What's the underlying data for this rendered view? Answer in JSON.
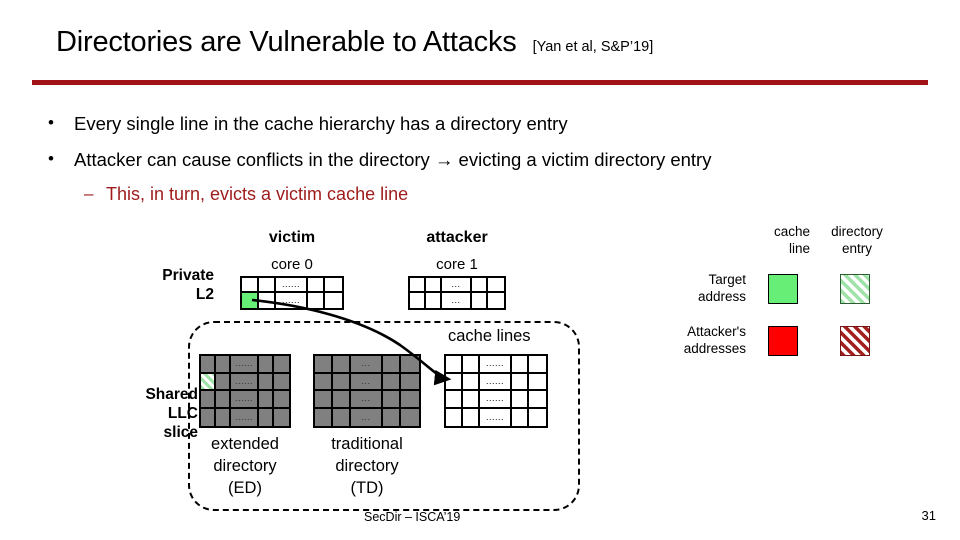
{
  "slide": {
    "title": "Directories are Vulnerable to Attacks",
    "citation": "[Yan et al, S&P’19]",
    "accent_color": "#A01216",
    "sub_bullet_color": "#9E1B1B",
    "footer": "SecDir – ISCA’19",
    "page_number": "31"
  },
  "bullets": [
    {
      "marker": "•",
      "text": "Every single line in the cache hierarchy has a directory entry",
      "level": 1
    },
    {
      "marker": "•",
      "text": "Attacker can cause conflicts in the directory → evicting a victim directory entry",
      "level": 1
    },
    {
      "marker": "–",
      "text": "This, in turn, evicts a victim cache line",
      "level": 2
    }
  ],
  "diagram": {
    "private_l2_label": "Private\nL2",
    "shared_llc_label": "Shared\nLLC\nslice",
    "cores": [
      {
        "role": "victim",
        "name": "core 0",
        "ellipsis": "......",
        "cols": 5,
        "rows": 2,
        "highlight_cell": {
          "row": 2,
          "col": 1,
          "style": "green"
        }
      },
      {
        "role": "attacker",
        "name": "core 1",
        "ellipsis": "...",
        "cols": 5,
        "rows": 2,
        "highlight_cell": null
      }
    ],
    "llc_blocks": [
      {
        "id": "extended-directory",
        "label": "extended\ndirectory\n(ED)",
        "cols": 5,
        "rows": 4,
        "fill": "gray",
        "ellipsis": "......",
        "highlight_cell": {
          "row": 2,
          "col": 1,
          "style": "hatch-green"
        }
      },
      {
        "id": "traditional-directory",
        "label": "traditional\ndirectory\n(TD)",
        "cols": 5,
        "rows": 4,
        "fill": "gray",
        "ellipsis": "...",
        "highlight_cell": null
      },
      {
        "id": "cache-lines",
        "label": "cache lines",
        "cols": 5,
        "rows": 4,
        "fill": "white",
        "ellipsis": "......",
        "highlight_cell": null
      }
    ]
  },
  "legend": {
    "columns": [
      "cache\nline",
      "directory\nentry"
    ],
    "rows": [
      {
        "label": "Target\naddress",
        "cache_line": "#66EE77",
        "directory_entry": "hatch-green"
      },
      {
        "label": "Attacker's\naddresses",
        "cache_line": "#FF0000",
        "directory_entry": "hatch-red"
      }
    ],
    "col_labels_flat": {
      "cache_line": "cache line",
      "directory_entry": "directory entry"
    },
    "row_labels_flat": {
      "target": "Target address",
      "attacker": "Attacker's addresses"
    }
  }
}
